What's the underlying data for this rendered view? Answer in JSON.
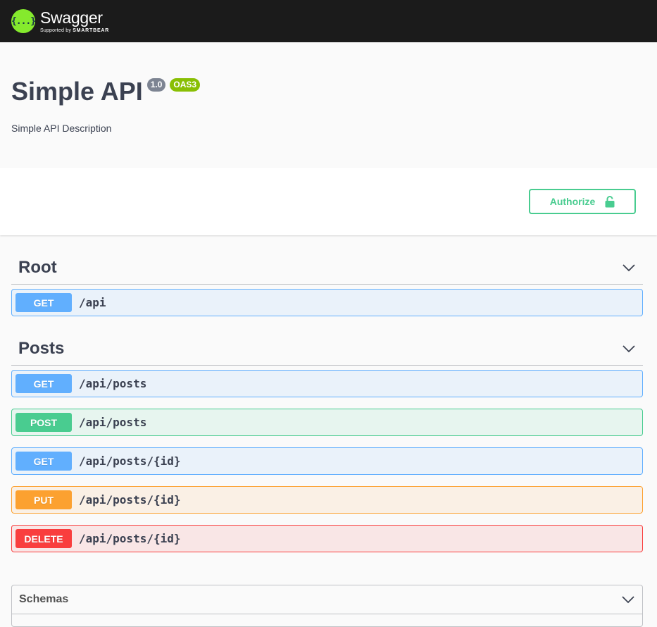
{
  "topbar": {
    "logo_mark": "{...}",
    "logo_title": "Swagger",
    "logo_sub_prefix": "Supported by",
    "logo_sub_brand": "SMARTBEAR"
  },
  "info": {
    "title": "Simple API",
    "version": "1.0",
    "oas": "OAS3",
    "description": "Simple API Description"
  },
  "authorize": {
    "label": "Authorize",
    "icon": "lock-icon"
  },
  "tags": [
    {
      "name": "Root",
      "operations": [
        {
          "method": "GET",
          "path": "/api"
        }
      ]
    },
    {
      "name": "Posts",
      "operations": [
        {
          "method": "GET",
          "path": "/api/posts"
        },
        {
          "method": "POST",
          "path": "/api/posts"
        },
        {
          "method": "GET",
          "path": "/api/posts/{id}"
        },
        {
          "method": "PUT",
          "path": "/api/posts/{id}"
        },
        {
          "method": "DELETE",
          "path": "/api/posts/{id}"
        }
      ]
    }
  ],
  "schemas": {
    "title": "Schemas"
  },
  "colors": {
    "get": "#61affe",
    "post": "#49cc90",
    "put": "#fca130",
    "delete": "#f93e3e",
    "brand": "#85ea2d"
  }
}
